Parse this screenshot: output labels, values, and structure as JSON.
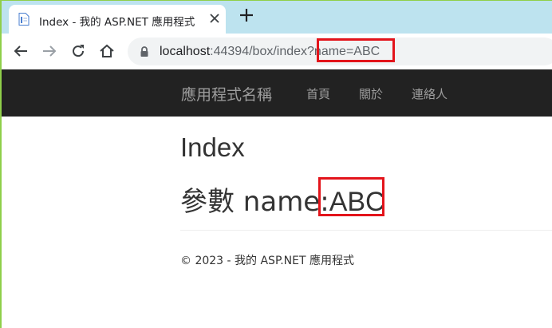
{
  "browser": {
    "tab": {
      "title": "Index - 我的 ASP.NET 應用程式",
      "favicon": "document-icon"
    },
    "new_tab_symbol": "+",
    "address_bar": {
      "host": "localhost",
      "port_path": ":44394/box/index",
      "query": "?name=ABC"
    },
    "highlight_color": "#e3141b"
  },
  "site": {
    "brand": "應用程式名稱",
    "nav": [
      {
        "label": "首頁"
      },
      {
        "label": "關於"
      },
      {
        "label": "連絡人"
      }
    ],
    "navbar_color": "#222222"
  },
  "content": {
    "heading": "Index",
    "param_label": "參數 name:",
    "param_value": "ABC"
  },
  "footer": {
    "text": "© 2023 - 我的 ASP.NET 應用程式"
  }
}
